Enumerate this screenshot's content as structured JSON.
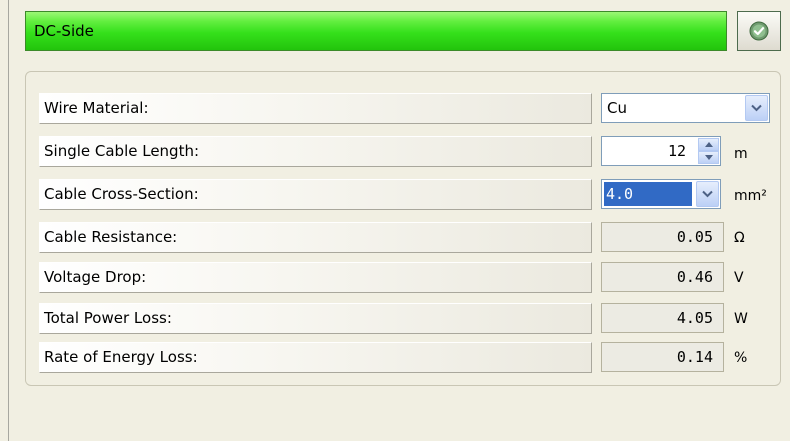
{
  "header": {
    "title": "DC-Side",
    "ok_icon": "check-circle-icon"
  },
  "rows": {
    "wire_material": {
      "label": "Wire Material:",
      "value": "Cu"
    },
    "single_cable_length": {
      "label": "Single Cable Length:",
      "value": "12",
      "unit": "m"
    },
    "cable_cross_section": {
      "label": "Cable Cross-Section:",
      "value": "4.0",
      "unit": "mm²"
    },
    "cable_resistance": {
      "label": "Cable Resistance:",
      "value": "0.05",
      "unit": "Ω"
    },
    "voltage_drop": {
      "label": "Voltage Drop:",
      "value": "0.46",
      "unit": "V"
    },
    "total_power_loss": {
      "label": "Total Power Loss:",
      "value": "4.05",
      "unit": "W"
    },
    "rate_energy_loss": {
      "label": "Rate of Energy Loss:",
      "value": "0.14",
      "unit": "%"
    }
  },
  "colors": {
    "header_green": "#35e01b",
    "selection_blue": "#316ac5"
  }
}
